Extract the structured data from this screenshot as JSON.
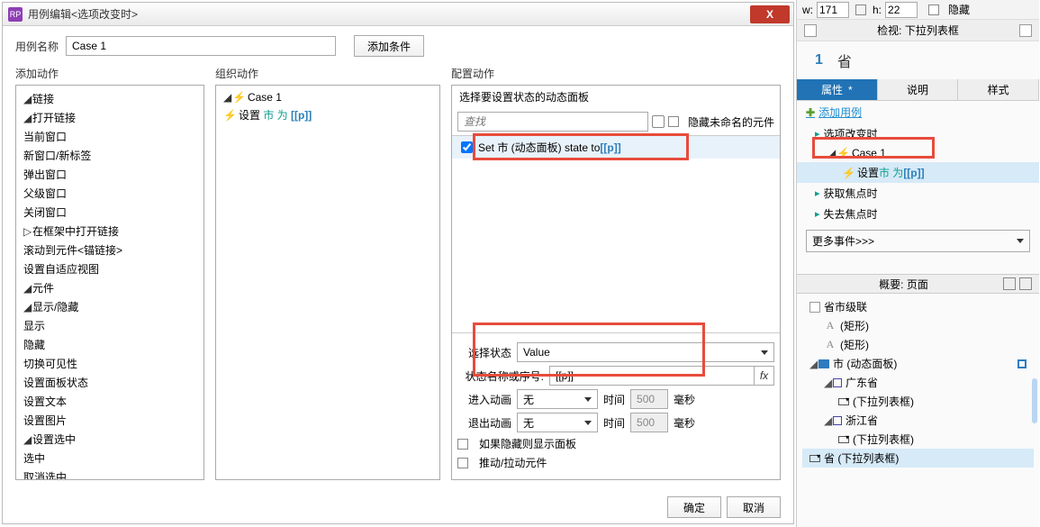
{
  "dialog": {
    "title": "用例编辑<选项改变时>",
    "close": "X",
    "case_name_label": "用例名称",
    "case_name_value": "Case 1",
    "add_condition": "添加条件",
    "col1_title": "添加动作",
    "col2_title": "组织动作",
    "col3_title": "配置动作",
    "ok": "确定",
    "cancel": "取消"
  },
  "actions_tree": {
    "n0": "链接",
    "n1": "打开链接",
    "n11": "当前窗口",
    "n12": "新窗口/新标签",
    "n13": "弹出窗口",
    "n14": "父级窗口",
    "n2": "关闭窗口",
    "n3": "在框架中打开链接",
    "n4": "滚动到元件<锚链接>",
    "n5": "设置自适应视图",
    "n6": "元件",
    "n7": "显示/隐藏",
    "n71": "显示",
    "n72": "隐藏",
    "n73": "切换可见性",
    "n8": "设置面板状态",
    "n9": "设置文本",
    "n10": "设置图片",
    "n15": "设置选中",
    "n151": "选中",
    "n152": "取消选中"
  },
  "organize": {
    "case": "Case 1",
    "set_prefix": "设置 ",
    "set_mid": "市 为 ",
    "set_bracket": "[[p]]"
  },
  "configure": {
    "select_panel_label": "选择要设置状态的动态面板",
    "search_placeholder": "查找",
    "hide_unnamed": "隐藏未命名的元件",
    "set_item_pre": "Set 市 (动态面板) state to ",
    "set_item_br": "[[p]]",
    "select_state": "选择状态",
    "state_value": "Value",
    "state_name_label": "状态名称或序号:",
    "state_name_value": "[[p]]",
    "fx": "fx",
    "anim_in": "进入动画",
    "anim_out": "退出动画",
    "anim_none": "无",
    "time_label": "时间",
    "time_value": "500",
    "ms": "毫秒",
    "opt1": "如果隐藏则显示面板",
    "opt2": "推动/拉动元件"
  },
  "rpanel": {
    "w": "w:",
    "wv": "171",
    "h": "h:",
    "hv": "22",
    "hidden": "隐藏",
    "inspect": "检视: 下拉列表框",
    "num": "1",
    "heading": "省",
    "tab1": "属性",
    "star": "*",
    "tab2": "说明",
    "tab3": "样式",
    "add_case": "添加用例",
    "ev1": "选项改变时",
    "case1": "Case 1",
    "set_pre": "设置 ",
    "set_mid": "市 为 ",
    "set_br": "[[p]]",
    "ev2": "获取焦点时",
    "ev3": "失去焦点时",
    "more": "更多事件>>>",
    "outline_title": "概要: 页面",
    "root": "省市级联",
    "rect": "(矩形)",
    "dyn": "市 (动态面板)",
    "gd": "广东省",
    "dd": "(下拉列表框)",
    "zj": "浙江省",
    "sheng": "省 (下拉列表框)"
  }
}
